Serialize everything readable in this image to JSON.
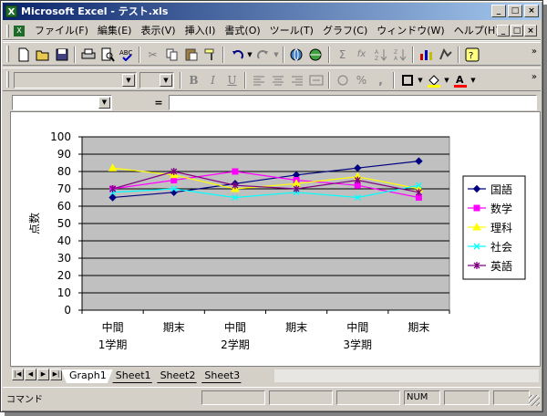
{
  "window": {
    "app_title": "Microsoft Excel - テスト.xls",
    "title_icon": "excel-icon",
    "buttons": [
      "minimize-icon",
      "maximize-icon",
      "close-icon"
    ],
    "buttons_glyphs": [
      "_",
      "□",
      "×"
    ]
  },
  "menubar": {
    "items": [
      "ファイル(F)",
      "編集(E)",
      "表示(V)",
      "挿入(I)",
      "書式(O)",
      "ツール(T)",
      "グラフ(C)",
      "ウィンドウ(W)",
      "ヘルプ(H)"
    ],
    "mdi_glyphs": [
      "_",
      "□",
      "×"
    ]
  },
  "toolbar_standard": {
    "icons": [
      "new-icon",
      "open-icon",
      "save-icon",
      "print-icon",
      "print-preview-icon",
      "spellcheck-icon",
      "cut-icon",
      "copy-icon",
      "paste-icon",
      "format-painter-icon",
      "undo-icon",
      "redo-icon",
      "hyperlink-icon",
      "web-icon",
      "autosum-icon",
      "function-icon",
      "sort-asc-icon",
      "sort-desc-icon",
      "chart-wizard-icon",
      "drawing-icon",
      "office-assistant-icon"
    ],
    "glyphs": {
      "autosum": "Σ",
      "function": "fx"
    }
  },
  "toolbar_format": {
    "font_value": "",
    "size_value": "",
    "bold": "B",
    "italic": "I",
    "underline": "U",
    "percent": "%",
    "comma": ","
  },
  "formula_bar": {
    "name_box": "",
    "equals": "=",
    "content": ""
  },
  "sheet_tabs": [
    "Graph1",
    "Sheet1",
    "Sheet2",
    "Sheet3"
  ],
  "active_tab": "Graph1",
  "statusbar": {
    "mode": "コマンド",
    "num": "NUM"
  },
  "chart_data": {
    "type": "line",
    "title": "",
    "xlabel": "",
    "ylabel": "点数",
    "ylim": [
      0,
      100
    ],
    "yticks": [
      0,
      10,
      20,
      30,
      40,
      50,
      60,
      70,
      80,
      90,
      100
    ],
    "categories": [
      [
        "中間",
        "1学期"
      ],
      [
        "期末",
        ""
      ],
      [
        "中間",
        "2学期"
      ],
      [
        "期末",
        ""
      ],
      [
        "中間",
        "3学期"
      ],
      [
        "期末",
        ""
      ]
    ],
    "grid": true,
    "legend_position": "right",
    "plot_background": "#c0c0c0",
    "series": [
      {
        "name": "国語",
        "color": "#000080",
        "marker": "diamond",
        "values": [
          65,
          68,
          73,
          78,
          82,
          86
        ]
      },
      {
        "name": "数学",
        "color": "#ff00ff",
        "marker": "square",
        "values": [
          70,
          75,
          80,
          75,
          72,
          65
        ]
      },
      {
        "name": "理科",
        "color": "#ffff00",
        "marker": "triangle",
        "values": [
          82,
          78,
          70,
          73,
          77,
          70
        ]
      },
      {
        "name": "社会",
        "color": "#00ffff",
        "marker": "x",
        "values": [
          68,
          70,
          65,
          68,
          65,
          72
        ]
      },
      {
        "name": "英語",
        "color": "#800080",
        "marker": "star",
        "values": [
          70,
          80,
          72,
          70,
          75,
          68
        ]
      }
    ]
  }
}
